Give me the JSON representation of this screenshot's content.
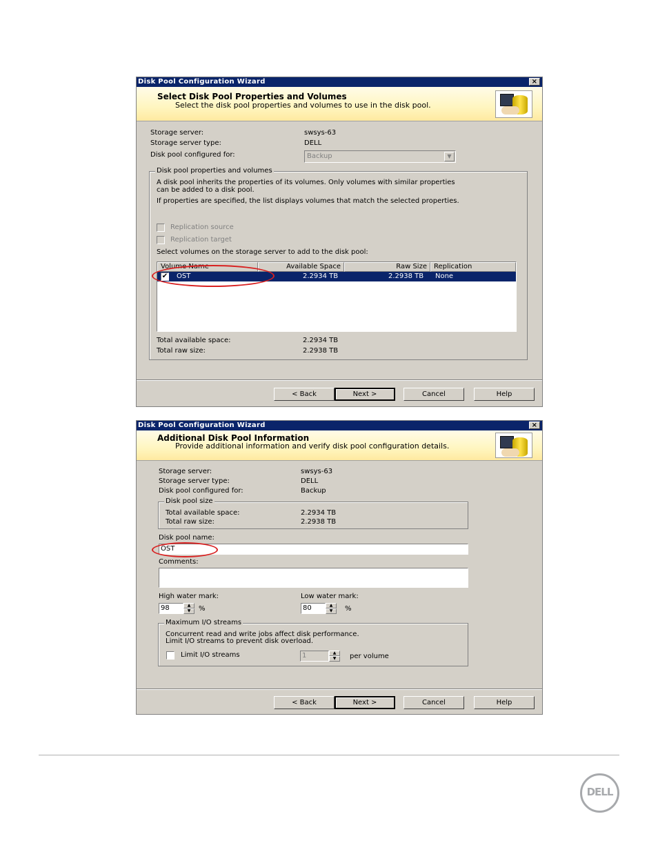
{
  "wizard1": {
    "title": "Disk Pool Configuration Wizard",
    "close": "×",
    "banner_title": "Select Disk Pool Properties and Volumes",
    "banner_subtitle": "Select the disk pool properties and volumes to use in the disk pool.",
    "storage_server_label": "Storage server:",
    "storage_server_value": "swsys-63",
    "storage_server_type_label": "Storage server type:",
    "storage_server_type_value": "DELL",
    "configured_for_label": "Disk pool configured for:",
    "configured_for_value": "Backup",
    "group_label": "Disk pool properties and volumes",
    "desc1": "A disk pool inherits the properties of its volumes. Only volumes with similar properties",
    "desc1b": "can be added to a disk pool.",
    "desc2": "If properties are specified, the list displays volumes that match the selected properties.",
    "replication_source": "Replication source",
    "replication_target": "Replication target",
    "select_volumes_label": "Select volumes on the storage server to add to the disk pool:",
    "columns": [
      "Volume Name",
      "Available Space",
      "Raw Size",
      "Replication"
    ],
    "rows": [
      {
        "checked": "✔",
        "name": "OST",
        "available": "2.2934 TB",
        "raw": "2.2938 TB",
        "replication": "None"
      }
    ],
    "total_available_label": "Total available space:",
    "total_available_value": "2.2934 TB",
    "total_raw_label": "Total raw size:",
    "total_raw_value": "2.2938 TB",
    "buttons": {
      "back": "< Back",
      "next": "Next >",
      "cancel": "Cancel",
      "help": "Help"
    }
  },
  "wizard2": {
    "title": "Disk Pool Configuration Wizard",
    "close": "×",
    "banner_title": "Additional Disk Pool Information",
    "banner_subtitle": "Provide additional information and verify disk pool configuration details.",
    "storage_server_label": "Storage server:",
    "storage_server_value": "swsys-63",
    "storage_server_type_label": "Storage server type:",
    "storage_server_type_value": "DELL",
    "configured_for_label": "Disk pool configured for:",
    "configured_for_value": "Backup",
    "size_group_label": "Disk pool size",
    "total_available_label": "Total available space:",
    "total_available_value": "2.2934 TB",
    "total_raw_label": "Total raw size:",
    "total_raw_value": "2.2938 TB",
    "pool_name_label": "Disk pool name:",
    "pool_name_value": "OST",
    "comments_label": "Comments:",
    "comments_value": "",
    "high_water_label": "High water mark:",
    "high_water_value": "98",
    "low_water_label": "Low water mark:",
    "low_water_value": "80",
    "percent": "%",
    "streams_group_label": "Maximum I/O streams",
    "streams_desc1": "Concurrent read and write jobs affect disk performance.",
    "streams_desc2": "Limit I/O streams to prevent disk overload.",
    "limit_streams_label": "Limit I/O streams",
    "limit_streams_value": "1",
    "per_volume": "per volume",
    "buttons": {
      "back": "< Back",
      "next": "Next >",
      "cancel": "Cancel",
      "help": "Help"
    }
  },
  "footer": {
    "logo_text": "DELL"
  }
}
